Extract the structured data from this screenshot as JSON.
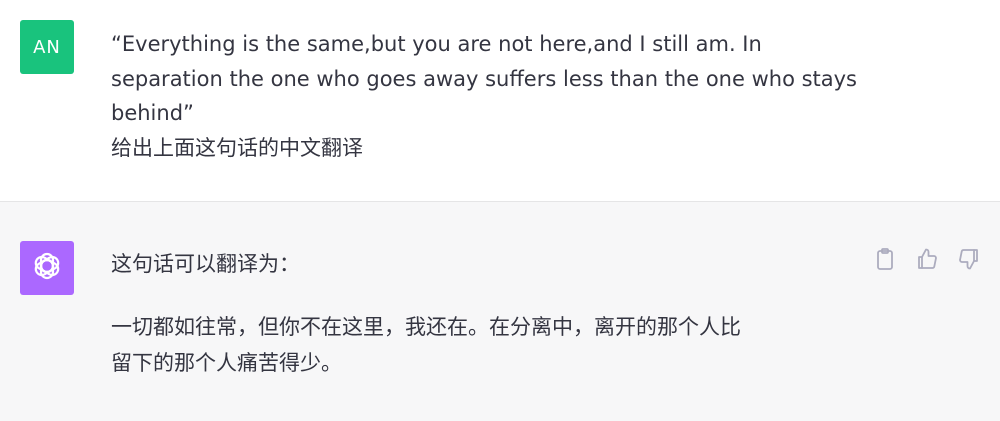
{
  "user_message": {
    "avatar_initials": "AN",
    "avatar_color": "#19c37d",
    "line1": "“Everything is the same,but you are not here,and I still am. In",
    "line2": "separation the one who goes away suffers less than the one who stays",
    "line3": "behind”",
    "line4": "给出上面这句话的中文翻译"
  },
  "assistant_message": {
    "avatar_icon": "openai-logo-icon",
    "avatar_color": "#ab68ff",
    "intro": "这句话可以翻译为：",
    "translation_line1": "一切都如往常，但你不在这里，我还在。在分离中，离开的那个人比",
    "translation_line2": "留下的那个人痛苦得少。",
    "actions": {
      "copy_icon": "clipboard-icon",
      "like_icon": "thumbs-up-icon",
      "dislike_icon": "thumbs-down-icon"
    }
  }
}
